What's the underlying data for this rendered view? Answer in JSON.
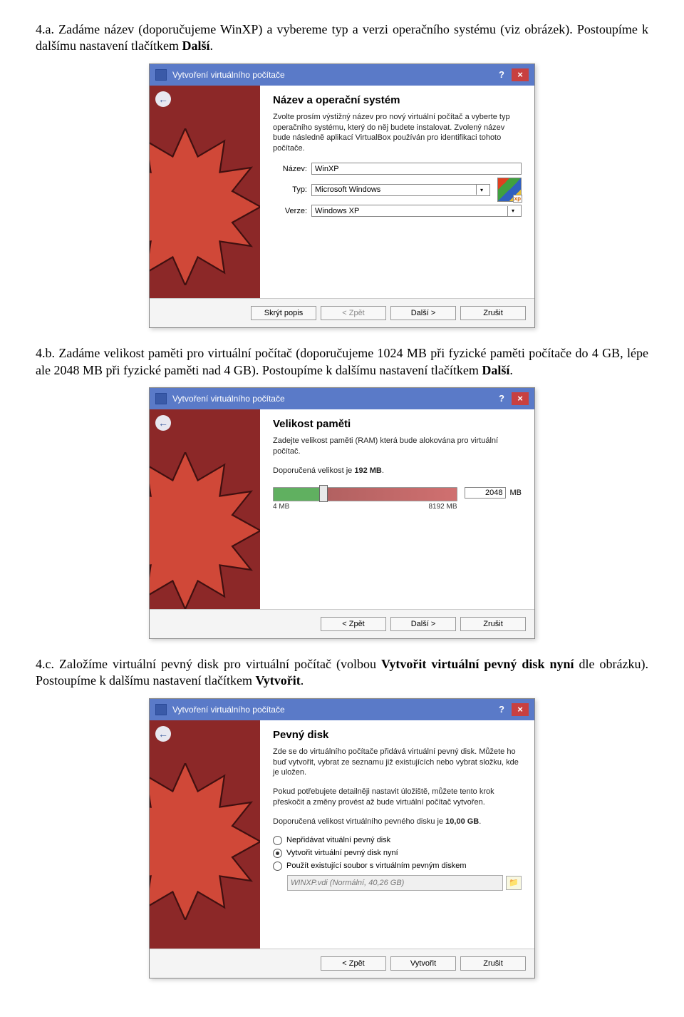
{
  "para1": {
    "prefix": "4.a. Zadáme název (doporučujeme WinXP) a vybereme typ a verzi operačního systému (viz obrázek). Postoupíme k dalšímu nastavení tlačítkem ",
    "bold": "Další",
    "suffix": "."
  },
  "para2": {
    "prefix": "4.b. Zadáme velikost paměti pro virtuální počítač (doporučujeme 1024 MB při fyzické paměti počítače do 4 GB, lépe ale 2048 MB při fyzické paměti nad 4 GB). Postoupíme k dalšímu nastavení tlačítkem ",
    "bold": "Další",
    "suffix": "."
  },
  "para3": {
    "prefix": "4.c. Založíme virtuální pevný disk pro virtuální počítač (volbou ",
    "bold1": "Vytvořit virtuální pevný disk nyní",
    "mid": " dle obrázku). Postoupíme k dalšímu nastavení tlačítkem ",
    "bold2": "Vytvořit",
    "suffix": "."
  },
  "dlg1": {
    "title": "Vytvoření virtuálního počítače",
    "heading": "Název a operační systém",
    "desc": "Zvolte prosím výstižný název pro nový virtuální počítač a vyberte typ operačního systému, který do něj budete instalovat. Zvolený název bude následně aplikací VirtualBox používán pro identifikaci tohoto počítače.",
    "name_label": "Název:",
    "name_value": "WinXP",
    "type_label": "Typ:",
    "type_value": "Microsoft Windows",
    "ver_label": "Verze:",
    "ver_value": "Windows XP",
    "xp_badge": "xp",
    "btn_hide": "Skrýt popis",
    "btn_back": "< Zpět",
    "btn_next": "Další >",
    "btn_cancel": "Zrušit"
  },
  "dlg2": {
    "title": "Vytvoření virtuálního počítače",
    "heading": "Velikost paměti",
    "desc1": "Zadejte velikost paměti (RAM) která bude alokována pro virtuální počítač.",
    "desc2_pre": "Doporučená velikost je ",
    "desc2_bold": "192 MB",
    "desc2_post": ".",
    "slider_min": "4 MB",
    "slider_max": "8192 MB",
    "value": "2048",
    "unit": "MB",
    "btn_back": "< Zpět",
    "btn_next": "Další >",
    "btn_cancel": "Zrušit"
  },
  "dlg3": {
    "title": "Vytvoření virtuálního počítače",
    "heading": "Pevný disk",
    "desc1": "Zde se do virtuálního počítače přidává virtuální pevný disk. Můžete ho buď vytvořit, vybrat ze seznamu již existujících nebo vybrat složku, kde je uložen.",
    "desc2": "Pokud potřebujete detailněji nastavit úložiště, můžete tento krok přeskočit a změny provést až bude virtuální počítač vytvořen.",
    "desc3_pre": "Doporučená velikost virtuálního pevného disku je ",
    "desc3_bold": "10,00 GB",
    "desc3_post": ".",
    "opt1": "Nepřidávat vituální pevný disk",
    "opt2": "Vytvořit virtuální pevný disk nyní",
    "opt3": "Použít existující soubor s virtuálním pevným diskem",
    "file_value": "WINXP.vdi (Normální, 40,26 GB)",
    "btn_back": "< Zpět",
    "btn_create": "Vytvořit",
    "btn_cancel": "Zrušit"
  }
}
